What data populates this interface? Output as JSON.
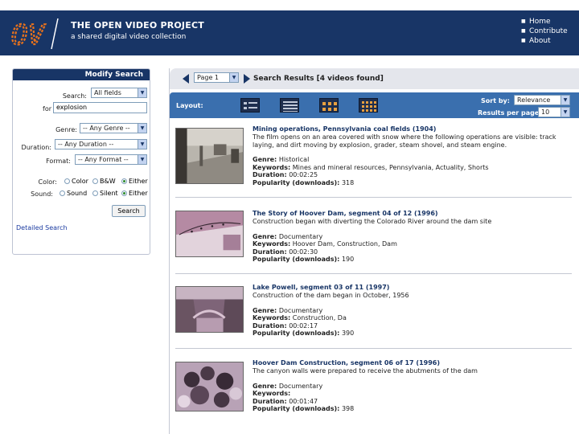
{
  "brand": {
    "title": "THE OPEN VIDEO PROJECT",
    "subtitle": "a shared digital video collection",
    "logo_text": "OV"
  },
  "top_nav": [
    "Home",
    "Contribute",
    "About"
  ],
  "sidebar": {
    "heading": "Modify Search",
    "search_label": "Search:",
    "search_field": "All fields",
    "for_label": "for",
    "query": "explosion",
    "genre_label": "Genre:",
    "genre_value": "-- Any Genre --",
    "duration_label": "Duration:",
    "duration_value": "-- Any Duration --",
    "format_label": "Format:",
    "format_value": "-- Any Format --",
    "color_label": "Color:",
    "color_options": [
      "Color",
      "B&W",
      "Either"
    ],
    "color_selected": "Either",
    "sound_label": "Sound:",
    "sound_options": [
      "Sound",
      "Silent",
      "Either"
    ],
    "sound_selected": "Either",
    "search_button": "Search",
    "detailed_link": "Detailed Search"
  },
  "results": {
    "page_select": "Page 1",
    "header": "Search Results",
    "count": "[4 videos found]",
    "layout_label": "Layout:",
    "sort_label": "Sort by:",
    "sort_value": "Relevance",
    "per_page_label": "Results per page:",
    "per_page_value": "10",
    "labels": {
      "genre": "Genre:",
      "keywords": "Keywords:",
      "duration": "Duration:",
      "popularity": "Popularity (downloads):"
    },
    "items": [
      {
        "title": "Mining operations, Pennsylvania coal fields (1904)",
        "description": "The film opens on an area covered with snow where the following operations are visible: track laying, and dirt moving by explosion, grader, steam shovel, and steam engine.",
        "genre": "Historical",
        "keywords": "Mines and mineral resources, Pennsylvania, Actuality, Shorts",
        "duration": "00:02:25",
        "popularity": "318"
      },
      {
        "title": "The Story of Hoover Dam, segment 04 of 12 (1996)",
        "description": "Construction began with diverting the Colorado River around the dam site",
        "genre": "Documentary",
        "keywords": "Hoover Dam, Construction, Dam",
        "duration": "00:02:30",
        "popularity": "190"
      },
      {
        "title": "Lake Powell, segment 03 of 11 (1997)",
        "description": "Construction of the dam began in October, 1956",
        "genre": "Documentary",
        "keywords": "Construction, Da",
        "duration": "00:02:17",
        "popularity": "390"
      },
      {
        "title": "Hoover Dam Construction, segment 06 of 17 (1996)",
        "description": "The canyon walls were prepared to receive the abutments of the dam",
        "genre": "Documentary",
        "keywords": "",
        "duration": "00:01:47",
        "popularity": "398"
      }
    ]
  },
  "colors": {
    "navy": "#183566",
    "toolbar_blue": "#3a6fae",
    "logo_orange": "#e8721c"
  }
}
